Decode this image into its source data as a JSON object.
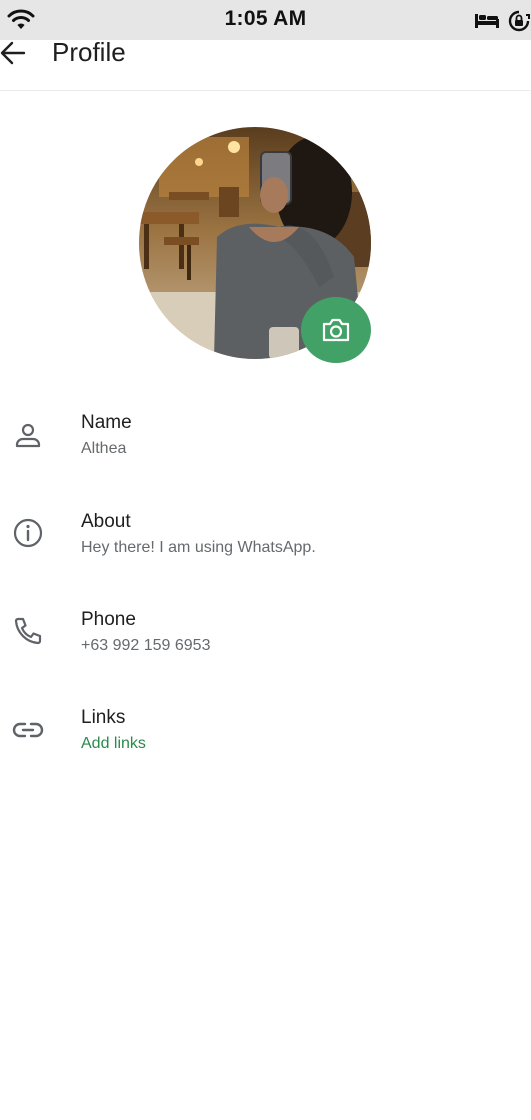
{
  "status_bar": {
    "time": "1:05 AM",
    "icons": [
      "wifi-icon",
      "bed-icon",
      "lock-rotation-icon"
    ]
  },
  "header": {
    "title": "Profile",
    "back_icon": "arrow-left-icon"
  },
  "avatar": {
    "description_icon": "profile-photo",
    "edit_icon": "camera-icon",
    "accent_color": "#42a166"
  },
  "fields": [
    {
      "icon": "person-icon",
      "label": "Name",
      "value": "Althea"
    },
    {
      "icon": "info-icon",
      "label": "About",
      "value": "Hey there! I am using WhatsApp."
    },
    {
      "icon": "phone-icon",
      "label": "Phone",
      "value": "+63 992 159 6953"
    },
    {
      "icon": "link-icon",
      "label": "Links",
      "value": "Add links",
      "value_color": "#2a8a4b"
    }
  ]
}
